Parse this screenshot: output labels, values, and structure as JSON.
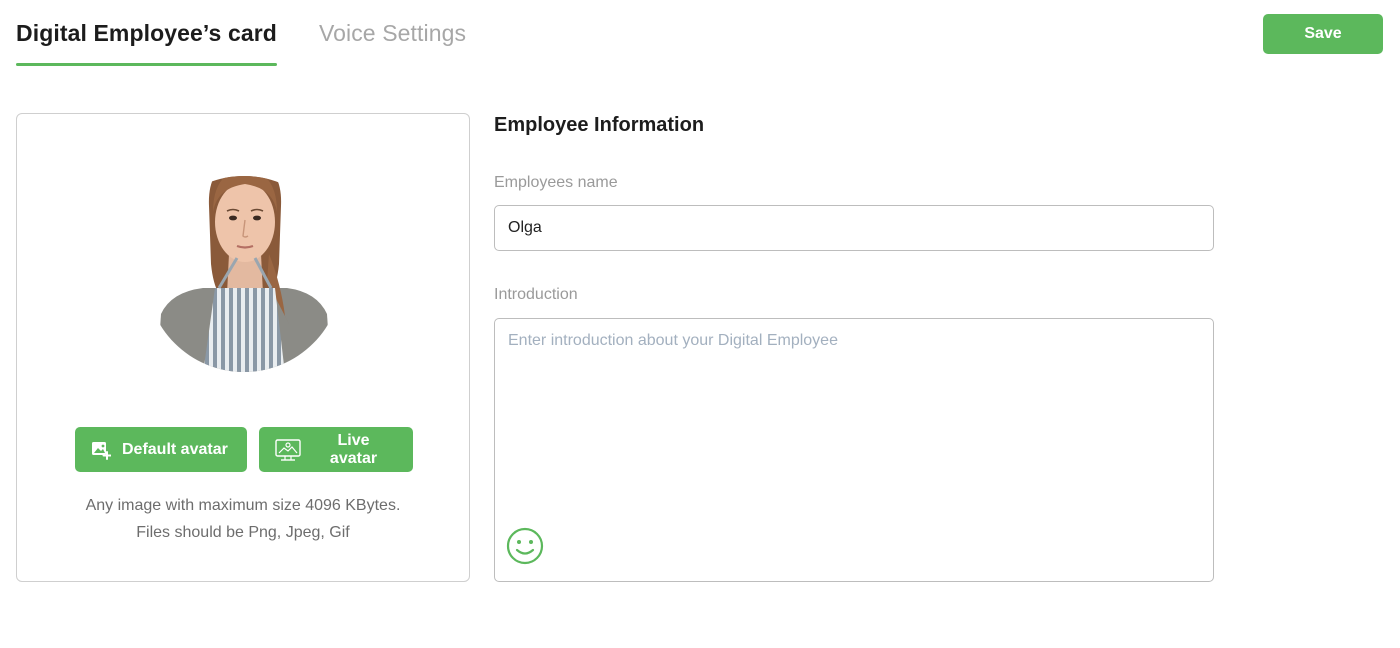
{
  "tabs": [
    {
      "label": "Digital Employee’s card",
      "active": true
    },
    {
      "label": "Voice Settings",
      "active": false
    }
  ],
  "header": {
    "save_label": "Save"
  },
  "avatar": {
    "default_button": "Default avatar",
    "live_button": "Live avatar",
    "hint_line1": "Any image with maximum size 4096 KBytes.",
    "hint_line2": "Files should be Png, Jpeg, Gif"
  },
  "info": {
    "title": "Employee Information",
    "name_label": "Employees name",
    "name_value": "Olga",
    "intro_label": "Introduction",
    "intro_placeholder": "Enter introduction about your Digital Employee",
    "intro_value": ""
  },
  "colors": {
    "accent": "#5cb85c",
    "border": "#cfcfcf",
    "muted_text": "#9a9a9a"
  },
  "icons": [
    "add-image-icon",
    "live-avatar-icon",
    "smiley-icon"
  ]
}
